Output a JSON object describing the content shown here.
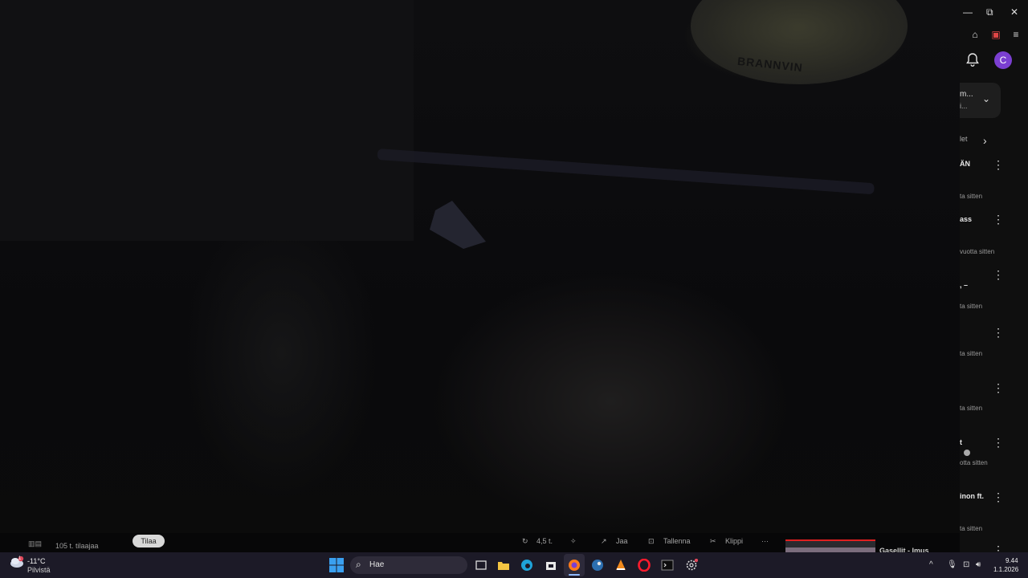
{
  "video": {
    "plate_text": "BRANNVIN"
  },
  "window_controls": {
    "minimize": "—",
    "restore": "⧉",
    "close": "✕"
  },
  "header": {
    "avatar_letter": "C"
  },
  "sidebar": {
    "chip_line1": "m...",
    "chip_line2": "i...",
    "filter_label": "let",
    "items": [
      {
        "title": "ÄN",
        "meta": "ta sitten"
      },
      {
        "title": "ass",
        "meta": "vuotta sitten"
      },
      {
        "title": ", –",
        "meta": "ta sitten"
      },
      {
        "title": "",
        "meta": "ta sitten"
      },
      {
        "title": "",
        "meta": "ta sitten"
      },
      {
        "title": "t",
        "meta": "otta sitten"
      },
      {
        "title": "inon ft.",
        "meta": "ta sitten"
      }
    ]
  },
  "player": {
    "subscribers": "105 t. tilaajaa",
    "subscribe_label": "Tilaa",
    "likes": "4,5 t.",
    "share_label": "Jaa",
    "save_label": "Tallenna",
    "clip_label": "Klippi",
    "more_label": "···",
    "next_title": "Gasellit - Imus"
  },
  "taskbar": {
    "weather_temp": "-11°C",
    "weather_desc": "Pilvistä",
    "weather_badge": "1",
    "search_label": "Hae",
    "time": "9.44",
    "date": "1.1.2026"
  },
  "colors": {
    "accent_avatar": "#7b3fd1",
    "progress_red": "#e02020",
    "taskbar_bg": "#1c1a27"
  }
}
